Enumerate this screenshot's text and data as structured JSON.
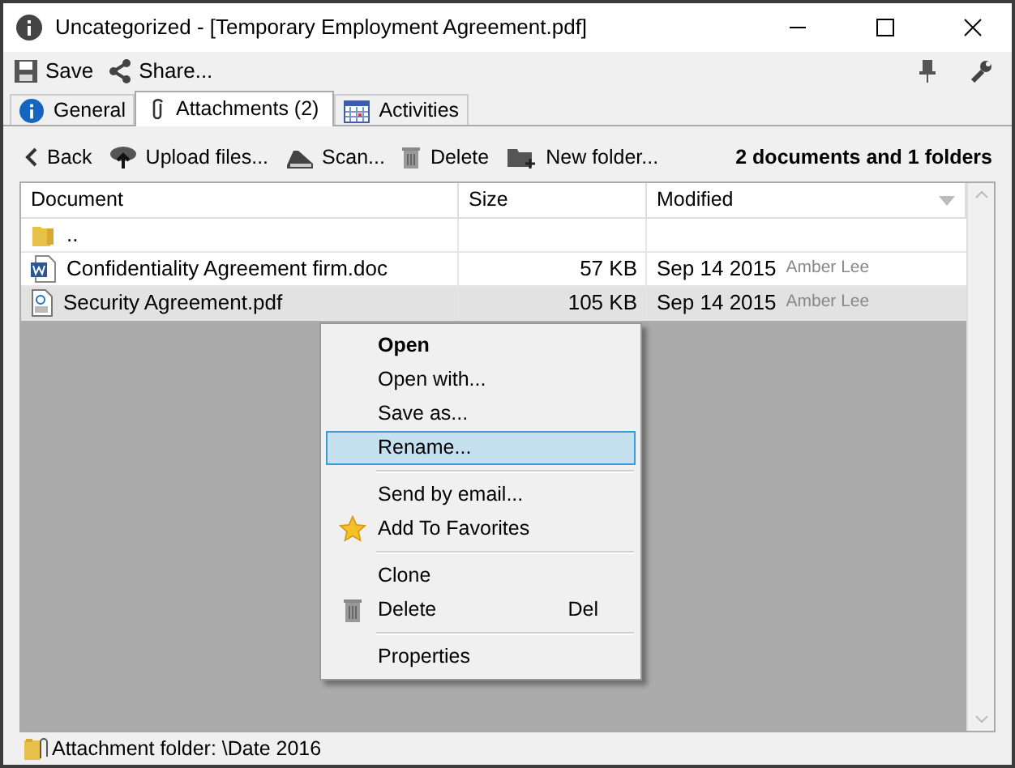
{
  "window": {
    "title": "Uncategorized - [Temporary Employment Agreement.pdf]"
  },
  "toolbar": [
    "Save",
    "Share..."
  ],
  "tabs": [
    {
      "label": "General",
      "selected": false
    },
    {
      "label": "Attachments (2)",
      "selected": true
    },
    {
      "label": "Activities",
      "selected": false
    }
  ],
  "nav": [
    "Back",
    "Upload files...",
    "Scan...",
    "Delete",
    "New folder..."
  ],
  "summary": "2 documents and 1 folders",
  "table": {
    "columns": [
      "Document",
      "Size",
      "Modified"
    ],
    "rows": [
      {
        "kind": "folder",
        "name": "..",
        "selected": false
      },
      {
        "kind": "word",
        "name": "Confidentiality Agreement firm.doc",
        "size": "57 KB",
        "date": "Sep 14 2015",
        "author": "Amber Lee",
        "selected": false
      },
      {
        "kind": "pdf",
        "name": "Security Agreement.pdf",
        "size": "105 KB",
        "date": "Sep 14 2015",
        "author": "Amber Lee",
        "selected": true
      }
    ]
  },
  "context_menu": {
    "groups": [
      [
        {
          "label": "Open",
          "default": true,
          "selected": false
        },
        {
          "label": "Open with...",
          "default": false,
          "selected": false
        },
        {
          "label": "Save as...",
          "default": false,
          "selected": false
        },
        {
          "label": "Rename...",
          "default": false,
          "selected": true
        }
      ],
      [
        {
          "label": "Send by email...",
          "default": false,
          "selected": false
        },
        {
          "label": "Add To Favorites",
          "default": false,
          "selected": false
        }
      ],
      [
        {
          "label": "Clone",
          "default": false,
          "selected": false
        },
        {
          "label": "Delete",
          "shortcut": "Del",
          "default": false,
          "selected": false
        }
      ],
      [
        {
          "label": "Properties",
          "default": false,
          "selected": false
        }
      ]
    ]
  },
  "status_bar": "Attachment folder: \\Date 2016"
}
